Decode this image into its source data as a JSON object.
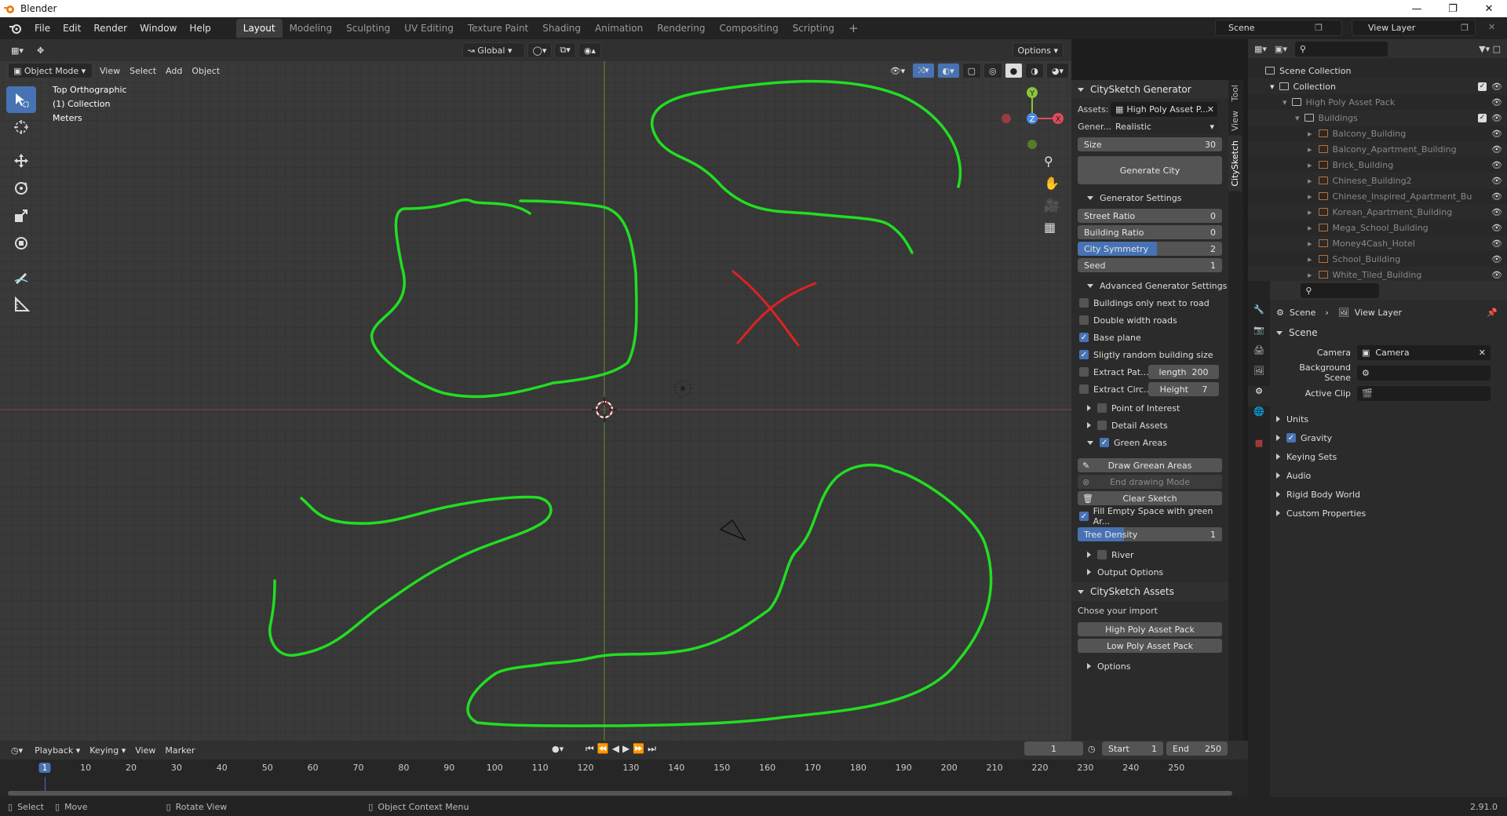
{
  "app": {
    "title": "Blender",
    "version": "2.91.0"
  },
  "menu": [
    "File",
    "Edit",
    "Render",
    "Window",
    "Help"
  ],
  "workspaces": [
    "Layout",
    "Modeling",
    "Sculpting",
    "UV Editing",
    "Texture Paint",
    "Shading",
    "Animation",
    "Rendering",
    "Compositing",
    "Scripting"
  ],
  "scene_name": "Scene",
  "view_layer": "View Layer",
  "viewport_header": {
    "mode": "Object Mode",
    "menus": [
      "View",
      "Select",
      "Add",
      "Object"
    ],
    "orientation": "Global",
    "options": "Options"
  },
  "viewport_info": {
    "view": "Top Orthographic",
    "collection": "(1) Collection",
    "units": "Meters"
  },
  "colors": {
    "accent": "#4772b3",
    "sketch_green": "#22dd22",
    "cross_red": "#dd2222",
    "x_axis": "#e04a5a",
    "y_axis": "#8cc43a",
    "z_axis": "#4a8ae0"
  },
  "npanel": {
    "tabs": [
      "Tool",
      "View",
      "CitySketch"
    ],
    "generator": {
      "title": "CitySketch Generator",
      "assets_label": "Assets:",
      "assets_value": "High Poly Asset P...",
      "gener_label": "Gener...",
      "gener_value": "Realistic",
      "size_label": "Size",
      "size_value": "30",
      "generate_button": "Generate City"
    },
    "generator_settings": {
      "title": "Generator Settings",
      "street_ratio_label": "Street Ratio",
      "street_ratio": "0",
      "building_ratio_label": "Building Ratio",
      "building_ratio": "0",
      "city_symmetry_label": "City Symmetry",
      "city_symmetry": "2",
      "seed_label": "Seed",
      "seed": "1"
    },
    "advanced": {
      "title": "Advanced Generator Settings",
      "buildings_next_road": "Buildings only next to road",
      "double_width": "Double width roads",
      "base_plane": "Base plane",
      "random_size": "Sligtly random building size",
      "extract_path": "Extract Pat...",
      "length_label": "length",
      "length_value": "200",
      "extract_circ": "Extract Circ...",
      "height_label": "Height",
      "height_value": "7"
    },
    "poi": "Point of Interest",
    "detail_assets": "Detail Assets",
    "green_areas": {
      "title": "Green Areas",
      "draw": "Draw Greean Areas",
      "end": "End drawing Mode",
      "clear": "Clear Sketch",
      "fill": "Fill Empty Space with green Ar...",
      "tree_density_label": "Tree Density",
      "tree_density": "1"
    },
    "river": "River",
    "output_options": "Output Options",
    "assets": {
      "title": "CitySketch Assets",
      "chose": "Chose your import",
      "high": "High Poly Asset Pack",
      "low": "Low Poly Asset Pack",
      "options": "Options"
    }
  },
  "outliner": {
    "scene_collection": "Scene Collection",
    "collection": "Collection",
    "asset_pack": "High Poly Asset Pack",
    "buildings": "Buildings",
    "items": [
      "Balcony_Building",
      "Balcony_Apartment_Building",
      "Brick_Building",
      "Chinese_Building2",
      "Chinese_Inspired_Apartment_Bu",
      "Korean_Apartment_Building",
      "Mega_School_Building",
      "Money4Cash_Hotel",
      "School_Building",
      "White_Tiled_Building"
    ]
  },
  "properties": {
    "breadcrumb_scene": "Scene",
    "breadcrumb_layer": "View Layer",
    "section": "Scene",
    "camera_label": "Camera",
    "camera_value": "Camera",
    "bg_scene_label": "Background Scene",
    "active_clip_label": "Active Clip",
    "panels": [
      "Units",
      "Gravity",
      "Keying Sets",
      "Audio",
      "Rigid Body World",
      "Custom Properties"
    ]
  },
  "timeline": {
    "menus": [
      "Playback",
      "Keying",
      "View",
      "Marker"
    ],
    "current_frame": "1",
    "start_label": "Start",
    "start": "1",
    "end_label": "End",
    "end": "250",
    "ticks": [
      "1",
      "10",
      "20",
      "30",
      "40",
      "50",
      "60",
      "70",
      "80",
      "90",
      "100",
      "110",
      "120",
      "130",
      "140",
      "150",
      "160",
      "170",
      "180",
      "190",
      "200",
      "210",
      "220",
      "230",
      "240",
      "250"
    ]
  },
  "status": {
    "select": "Select",
    "move": "Move",
    "rotate": "Rotate View",
    "context": "Object Context Menu"
  }
}
